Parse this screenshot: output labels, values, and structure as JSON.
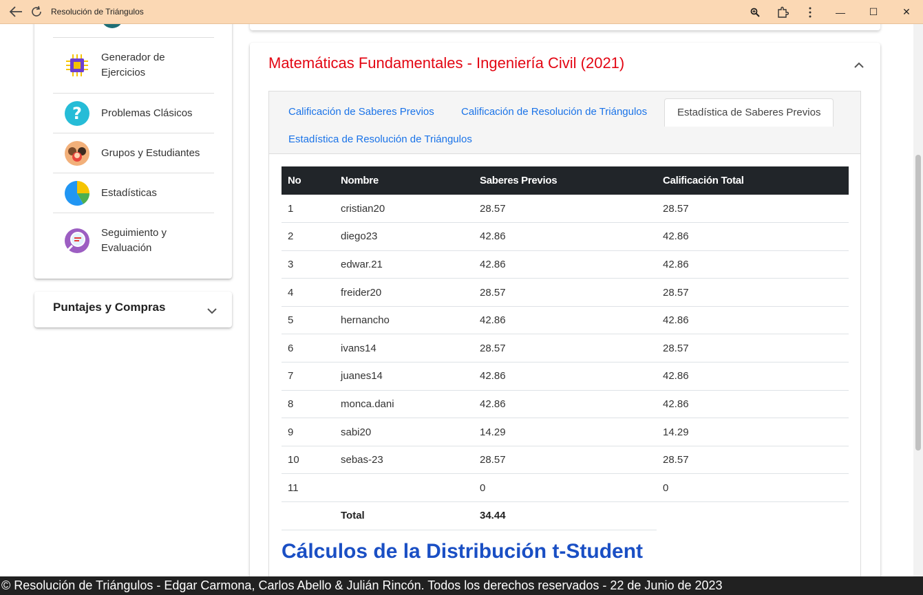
{
  "window": {
    "title": "Resolución de Triángulos",
    "minimize": "—",
    "maximize": "☐",
    "close": "✕"
  },
  "sidebar": {
    "items": [
      {
        "label": "Generador de\nEjercicios",
        "icon": "chip-icon"
      },
      {
        "label": "Problemas Clásicos",
        "icon": "question-icon"
      },
      {
        "label": "Grupos y Estudiantes",
        "icon": "students-icon"
      },
      {
        "label": "Estadísticas",
        "icon": "pie-chart-icon"
      },
      {
        "label": "Seguimiento y\nEvaluación",
        "icon": "magnifier-icon"
      }
    ],
    "accordion": {
      "label": "Puntajes y Compras"
    }
  },
  "main": {
    "title": "Matemáticas Fundamentales - Ingeniería Civil (2021)",
    "tabs": [
      {
        "label": "Calificación de Saberes Previos",
        "active": false
      },
      {
        "label": "Calificación de Resolución de Triángulos",
        "active": false
      },
      {
        "label": "Estadística de Saberes Previos",
        "active": true
      },
      {
        "label": "Estadística de Resolución de Triángulos",
        "active": false
      }
    ],
    "table": {
      "headers": [
        "No",
        "Nombre",
        "Saberes Previos",
        "Calificación Total"
      ],
      "rows": [
        [
          "1",
          "cristian20",
          "28.57",
          "28.57"
        ],
        [
          "2",
          "diego23",
          "42.86",
          "42.86"
        ],
        [
          "3",
          "edwar.21",
          "42.86",
          "42.86"
        ],
        [
          "4",
          "freider20",
          "28.57",
          "28.57"
        ],
        [
          "5",
          "hernancho",
          "42.86",
          "42.86"
        ],
        [
          "6",
          "ivans14",
          "28.57",
          "28.57"
        ],
        [
          "7",
          "juanes14",
          "42.86",
          "42.86"
        ],
        [
          "8",
          "monca.dani",
          "42.86",
          "42.86"
        ],
        [
          "9",
          "sabi20",
          "14.29",
          "14.29"
        ],
        [
          "10",
          "sebas-23",
          "28.57",
          "28.57"
        ],
        [
          "11",
          "",
          "0",
          "0"
        ]
      ],
      "total": {
        "label": "Total",
        "value": "34.44"
      }
    },
    "section_title": "Cálculos de la Distribución t-Student"
  },
  "footer": {
    "text": "© Resolución de Triángulos - Edgar Carmona, Carlos Abello & Julián Rincón. Todos los derechos reservados - 22 de Junio de 2023"
  }
}
